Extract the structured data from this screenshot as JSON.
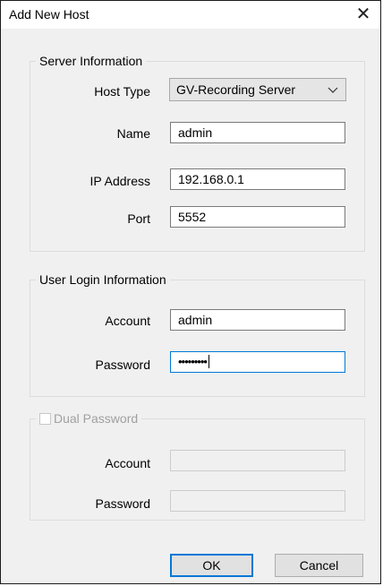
{
  "window": {
    "title": "Add New Host",
    "close_glyph": "✕"
  },
  "server": {
    "legend": "Server Information",
    "host_type_label": "Host Type",
    "host_type_value": "GV-Recording Server",
    "name_label": "Name",
    "name_value": "admin",
    "ip_label": "IP Address",
    "ip_value": "192.168.0.1",
    "port_label": "Port",
    "port_value": "5552"
  },
  "login": {
    "legend": "User Login Information",
    "account_label": "Account",
    "account_value": "admin",
    "password_label": "Password",
    "password_value": "•••••••••"
  },
  "dual": {
    "legend": "Dual Password",
    "checked": false,
    "account_label": "Account",
    "account_value": "",
    "password_label": "Password",
    "password_value": ""
  },
  "buttons": {
    "ok": "OK",
    "cancel": "Cancel"
  },
  "icons": {
    "close": "close-icon",
    "dropdown": "chevron-down-icon"
  },
  "colors": {
    "focus_border": "#0078d7",
    "dialog_bg": "#f0f0f0"
  }
}
